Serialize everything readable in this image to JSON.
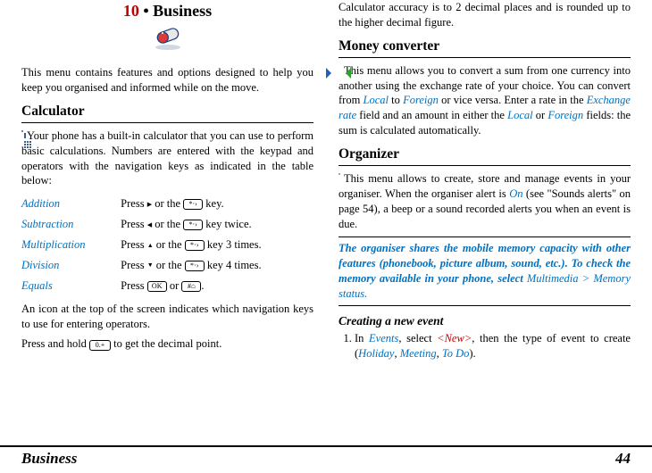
{
  "chapter": {
    "num": "10",
    "bullet": "•",
    "title": "Business"
  },
  "left": {
    "intro": "This menu contains features and options designed to help you keep you organised and informed while on the move.",
    "calc_heading": "Calculator",
    "calc_intro": "Your phone has a built-in calculator that you can use to perform basic calculations. Numbers are entered with the keypad and operators with the navigation keys as indicated in the table below:",
    "ops": {
      "add": {
        "name": "Addition",
        "p1": "Press ",
        "sym": "▶",
        "p2": " or the ",
        "p3": " key."
      },
      "sub": {
        "name": "Subtraction",
        "p1": "Press ",
        "sym": "◀",
        "p2": " or the ",
        "p3": " key twice."
      },
      "mul": {
        "name": "Multiplication",
        "p1": "Press ",
        "sym": "▲",
        "p2": " or the ",
        "p3": " key 3 times."
      },
      "div": {
        "name": "Division",
        "p1": "Press ",
        "sym": "▼",
        "p2": " or the ",
        "p3": " key 4 times."
      },
      "eq": {
        "name": "Equals",
        "p1": "Press ",
        "p2": " or ",
        "p3": "."
      }
    },
    "key_star": "*·›",
    "key_ok": "OK",
    "key_hash": "#⌂",
    "key_zero": "0.+",
    "calc_tail1": "An icon at the top of the screen indicates which navigation keys to use for entering operators.",
    "calc_tail2a": "Press and hold ",
    "calc_tail2b": " to get the decimal point."
  },
  "right": {
    "accuracy": "Calculator accuracy is to 2 decimal places and is rounded up to the higher decimal figure.",
    "money_heading": "Money converter",
    "money_p1a": "This menu allows you to convert a sum from one currency into another using the exchange rate of your choice. You can convert from ",
    "money_local": "Local",
    "money_p1b": " to ",
    "money_foreign": "Foreign",
    "money_p1c": " or vice versa. Enter a rate in the ",
    "money_rate": "Exchange rate",
    "money_p1d": " field and an amount in either the ",
    "money_p1e": " or ",
    "money_p1f": " fields: the sum is calculated automatically.",
    "org_heading": "Organizer",
    "org_p1a": "This menu allows to create, store and manage events in your organiser. When the organiser alert is ",
    "org_on": "On",
    "org_p1b": " (see \"Sounds alerts\" on page 54), a beep or a sound recorded alerts you when an event is due.",
    "note_a": "The organiser shares the mobile memory capacity with other features (phonebook, picture album, sound, etc.). To check the memory available in your phone, select ",
    "note_path": "Multimedia > Memory status.",
    "create_heading": "Creating a new event",
    "step1_a": "In ",
    "step1_events": "Events",
    "step1_b": ", select ",
    "step1_new": "<New>",
    "step1_c": ", then the type of event to create (",
    "step1_holiday": "Holiday",
    "step1_d": ", ",
    "step1_meeting": "Meeting",
    "step1_e": ", ",
    "step1_todo": "To Do",
    "step1_f": ")."
  },
  "footer": {
    "section": "Business",
    "page": "44"
  }
}
